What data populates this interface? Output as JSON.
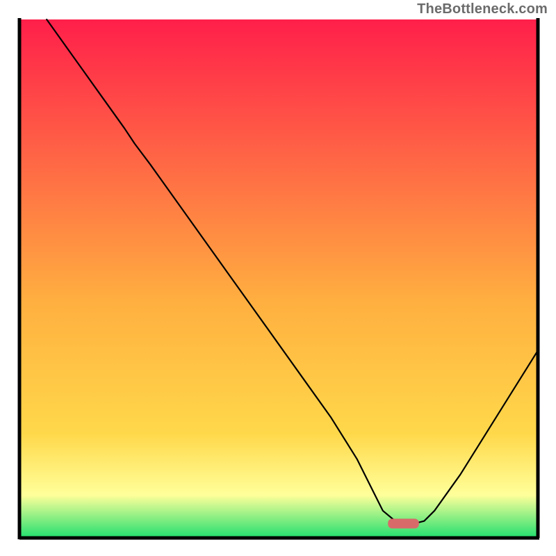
{
  "watermark": "TheBottleneck.com",
  "chart_data": {
    "type": "line",
    "title": "",
    "xlabel": "",
    "ylabel": "",
    "xlim": [
      0,
      100
    ],
    "ylim": [
      0,
      100
    ],
    "grid": false,
    "legend": false,
    "background_gradient": {
      "top_color": "#ff1f4a",
      "mid_color": "#ffd84a",
      "near_bottom_color": "#ffff9a",
      "bottom_color": "#28e070"
    },
    "optimal_marker": {
      "x_start": 71,
      "x_end": 77,
      "y": 2.5,
      "color": "#d86a6a",
      "shape": "rounded-bar"
    },
    "series": [
      {
        "name": "bottleneck-curve",
        "color": "#000000",
        "stroke_width": 2,
        "x": [
          5,
          10,
          15,
          20,
          22,
          25,
          30,
          35,
          40,
          45,
          50,
          55,
          60,
          65,
          68,
          70,
          73,
          76,
          78,
          80,
          85,
          90,
          95,
          100
        ],
        "y": [
          100,
          93,
          86,
          79,
          76,
          72,
          65,
          58,
          51,
          44,
          37,
          30,
          23,
          15,
          9,
          5,
          2.5,
          2.5,
          3,
          5,
          12,
          20,
          28,
          36
        ]
      }
    ]
  }
}
